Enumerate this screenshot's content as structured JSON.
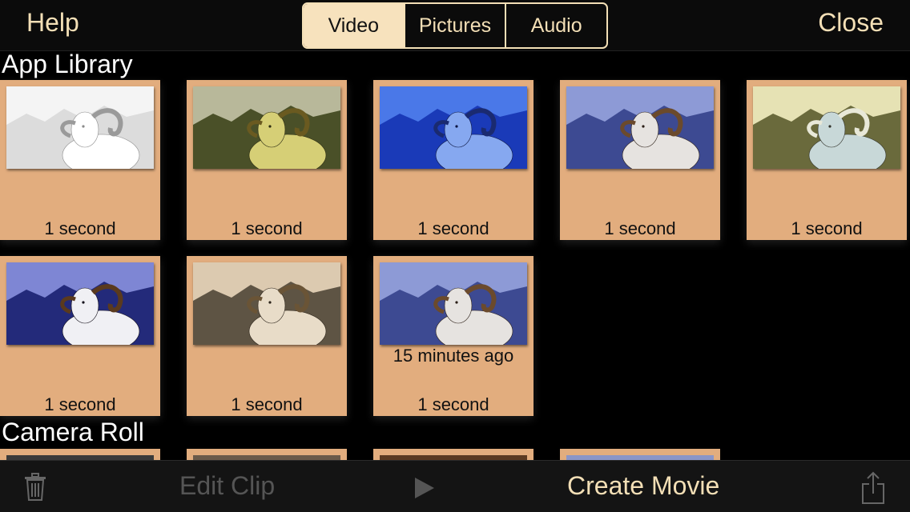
{
  "topbar": {
    "help_label": "Help",
    "close_label": "Close",
    "tabs": [
      {
        "label": "Video",
        "active": true
      },
      {
        "label": "Pictures",
        "active": false
      },
      {
        "label": "Audio",
        "active": false
      }
    ]
  },
  "sections": {
    "app_library": "App Library",
    "camera_roll": "Camera Roll"
  },
  "app_library": [
    {
      "caption": "1 second",
      "subcaption": "",
      "style": "sketch"
    },
    {
      "caption": "1 second",
      "subcaption": "",
      "style": "olive"
    },
    {
      "caption": "1 second",
      "subcaption": "",
      "style": "blue"
    },
    {
      "caption": "1 second",
      "subcaption": "",
      "style": "natural"
    },
    {
      "caption": "1 second",
      "subcaption": "",
      "style": "inverted"
    },
    {
      "caption": "1 second",
      "subcaption": "",
      "style": "vivid"
    },
    {
      "caption": "1 second",
      "subcaption": "",
      "style": "sepia"
    },
    {
      "caption": "1 second",
      "subcaption": "15 minutes ago",
      "style": "natural"
    }
  ],
  "bottombar": {
    "edit_clip_label": "Edit Clip",
    "create_movie_label": "Create Movie",
    "trash_icon": "trash-icon",
    "play_icon": "play-icon",
    "share_icon": "share-icon"
  },
  "colors": {
    "accent": "#f3dfb6",
    "tile": "#e2ad7e",
    "disabled": "#555555"
  }
}
